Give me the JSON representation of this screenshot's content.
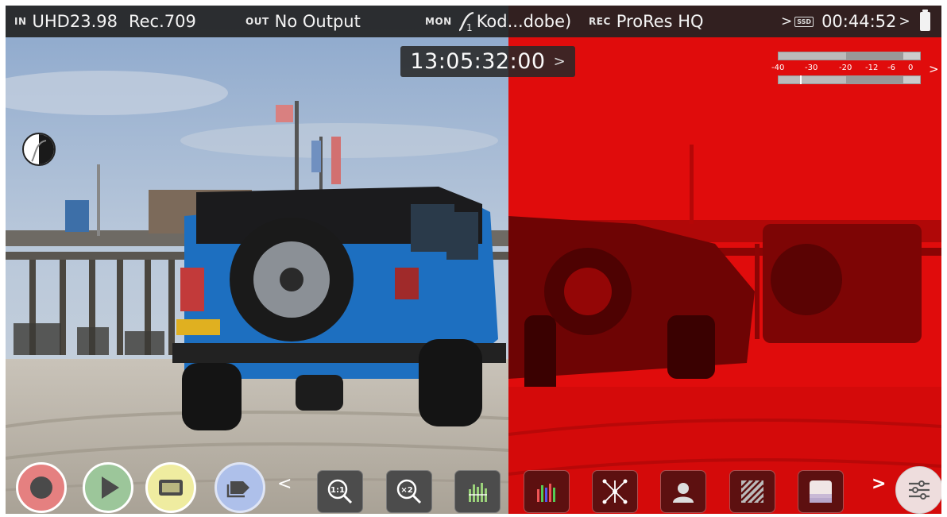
{
  "status_bar": {
    "input_label": "IN",
    "input_format": "UHD23.98",
    "input_gamut": "Rec.709",
    "output_label": "OUT",
    "output_value": "No Output",
    "monitor_label": "MON",
    "monitor_lut": "Kod...dobe)",
    "record_label": "REC",
    "record_codec": "ProRes HQ",
    "media_label": "SSD",
    "record_time_remaining": "00:44:52"
  },
  "timecode": "13:05:32:00",
  "audio_meter": {
    "scale": [
      "-40",
      "-30",
      "-20",
      "-12",
      "-6",
      "0"
    ]
  },
  "toolbar": {
    "buttons": [
      {
        "name": "record",
        "icon": "record-icon"
      },
      {
        "name": "play",
        "icon": "play-icon"
      },
      {
        "name": "display",
        "icon": "display-icon"
      },
      {
        "name": "tag",
        "icon": "tag-icon"
      },
      {
        "name": "zoom-1to1",
        "icon": "zoom-1to1-icon"
      },
      {
        "name": "zoom-2x",
        "icon": "zoom-2x-icon"
      },
      {
        "name": "waveform",
        "icon": "waveform-icon"
      },
      {
        "name": "vectorscope",
        "icon": "vectorscope-icon"
      },
      {
        "name": "focus-peaking",
        "icon": "focus-peaking-icon"
      },
      {
        "name": "false-color",
        "icon": "false-color-icon"
      },
      {
        "name": "zebra",
        "icon": "zebra-icon"
      },
      {
        "name": "frame-guides",
        "icon": "frame-guides-icon"
      },
      {
        "name": "menu",
        "icon": "menu-sliders-icon"
      }
    ]
  },
  "colors": {
    "false_color_red": "#e00c0c",
    "record_button": "#e58080",
    "play_button": "#9cc69a",
    "display_button": "#efeca0",
    "tag_button": "#aec0ea"
  }
}
